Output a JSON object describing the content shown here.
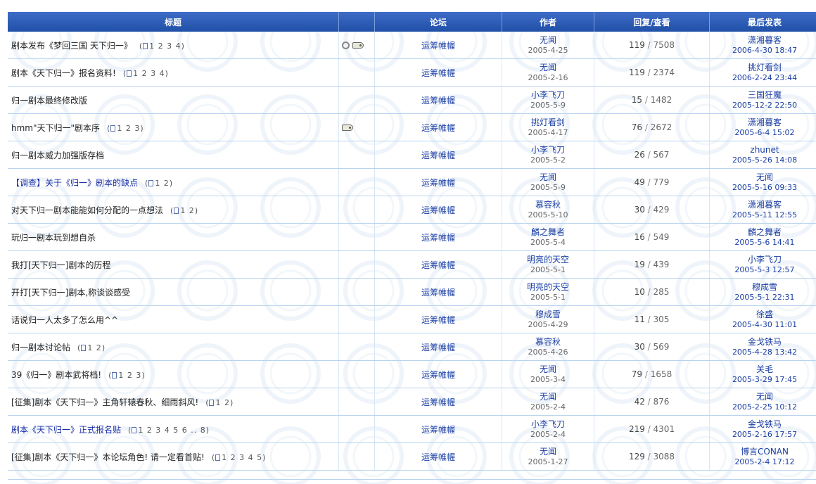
{
  "header": {
    "title": "标题",
    "forum": "论坛",
    "author": "作者",
    "reply_view": "回复/查看",
    "last_post": "最后发表"
  },
  "rows": [
    {
      "title": "剧本发布《梦回三国 天下归一》",
      "bold": false,
      "pages": "1 2 3 4",
      "attachment": true,
      "tagicon": true,
      "forum": "运筹帷幄",
      "author": "无闻",
      "date": "2005-4-25",
      "replies": "119",
      "views": "7508",
      "last_user": "潇湘暮客",
      "last_time": "2006-4-30 18:47"
    },
    {
      "title": "剧本《天下归一》报名资料!",
      "bold": false,
      "pages": "1 2 3 4",
      "attachment": false,
      "tagicon": false,
      "forum": "运筹帷幄",
      "author": "无闻",
      "date": "2005-2-16",
      "replies": "119",
      "views": "2374",
      "last_user": "挑灯看剑",
      "last_time": "2006-2-24 23:44"
    },
    {
      "title": "归一剧本最终修改版",
      "bold": false,
      "pages": "",
      "attachment": false,
      "tagicon": false,
      "forum": "运筹帷幄",
      "author": "小李飞刀",
      "date": "2005-5-9",
      "replies": "15",
      "views": "1482",
      "last_user": "三国狂魔",
      "last_time": "2005-12-2 22:50"
    },
    {
      "title": "hmm\"天下归一\"剧本序",
      "bold": false,
      "pages": "1 2 3",
      "attachment": false,
      "tagicon": true,
      "forum": "运筹帷幄",
      "author": "挑灯看剑",
      "date": "2005-4-17",
      "replies": "76",
      "views": "2672",
      "last_user": "潇湘暮客",
      "last_time": "2005-6-4 15:02"
    },
    {
      "title": "归一剧本威力加强版存档",
      "bold": false,
      "pages": "",
      "attachment": false,
      "tagicon": false,
      "forum": "运筹帷幄",
      "author": "小李飞刀",
      "date": "2005-5-2",
      "replies": "26",
      "views": "567",
      "last_user": "zhunet",
      "last_time": "2005-5-26 14:08"
    },
    {
      "title": "【调查】关于《归一》剧本的缺点",
      "bold": true,
      "pages": "1 2",
      "attachment": false,
      "tagicon": false,
      "forum": "运筹帷幄",
      "author": "无闻",
      "date": "2005-5-9",
      "replies": "49",
      "views": "779",
      "last_user": "无闻",
      "last_time": "2005-5-16 09:33"
    },
    {
      "title": "对天下归一剧本能能如何分配的一点想法",
      "bold": false,
      "pages": "1 2",
      "attachment": false,
      "tagicon": false,
      "forum": "运筹帷幄",
      "author": "慕容秋",
      "date": "2005-5-10",
      "replies": "30",
      "views": "429",
      "last_user": "潇湘暮客",
      "last_time": "2005-5-11 12:55"
    },
    {
      "title": "玩归一剧本玩到想自杀",
      "bold": false,
      "pages": "",
      "attachment": false,
      "tagicon": false,
      "forum": "运筹帷幄",
      "author": "麟之舞者",
      "date": "2005-5-4",
      "replies": "16",
      "views": "549",
      "last_user": "麟之舞者",
      "last_time": "2005-5-6 14:41"
    },
    {
      "title": "我打[天下归一]剧本的历程",
      "bold": false,
      "pages": "",
      "attachment": false,
      "tagicon": false,
      "forum": "运筹帷幄",
      "author": "明亮的天空",
      "date": "2005-5-1",
      "replies": "19",
      "views": "439",
      "last_user": "小李飞刀",
      "last_time": "2005-5-3 12:57"
    },
    {
      "title": "开打[天下归一]剧本,称谈谈感受",
      "bold": false,
      "pages": "",
      "attachment": false,
      "tagicon": false,
      "forum": "运筹帷幄",
      "author": "明亮的天空",
      "date": "2005-5-1",
      "replies": "10",
      "views": "285",
      "last_user": "穆成雪",
      "last_time": "2005-5-1 22:31"
    },
    {
      "title": "话说归一人太多了怎么用^^",
      "bold": false,
      "pages": "",
      "attachment": false,
      "tagicon": false,
      "forum": "运筹帷幄",
      "author": "穆成雪",
      "date": "2005-4-29",
      "replies": "11",
      "views": "305",
      "last_user": "徐盛",
      "last_time": "2005-4-30 11:01"
    },
    {
      "title": "归一剧本讨论帖",
      "bold": false,
      "pages": "1 2",
      "attachment": false,
      "tagicon": false,
      "forum": "运筹帷幄",
      "author": "慕容秋",
      "date": "2005-4-26",
      "replies": "30",
      "views": "569",
      "last_user": "金戈铁马",
      "last_time": "2005-4-28 13:42"
    },
    {
      "title": "39《归一》剧本武将档!",
      "bold": false,
      "pages": "1 2 3",
      "attachment": false,
      "tagicon": false,
      "forum": "运筹帷幄",
      "author": "无闻",
      "date": "2005-3-4",
      "replies": "79",
      "views": "1658",
      "last_user": "关毛",
      "last_time": "2005-3-29 17:45"
    },
    {
      "title": "[征集]剧本《天下归一》主角轩辕春秋、细雨斜风!",
      "bold": false,
      "pages": "1 2",
      "attachment": false,
      "tagicon": false,
      "forum": "运筹帷幄",
      "author": "无闻",
      "date": "2005-2-4",
      "replies": "42",
      "views": "876",
      "last_user": "无闻",
      "last_time": "2005-2-25 10:12"
    },
    {
      "title": "剧本《天下归一》正式报名贴",
      "bold": true,
      "pages": "1 2 3 4 5 6 .. 8",
      "attachment": false,
      "tagicon": false,
      "forum": "运筹帷幄",
      "author": "小李飞刀",
      "date": "2005-2-4",
      "replies": "219",
      "views": "4301",
      "last_user": "金戈铁马",
      "last_time": "2005-2-16 17:57"
    },
    {
      "title": "[征集]剧本《天下归一》本论坛角色! 请一定看首贴!",
      "bold": false,
      "pages": "1 2 3 4 5",
      "attachment": false,
      "tagicon": false,
      "forum": "运筹帷幄",
      "author": "无闻",
      "date": "2005-1-27",
      "replies": "129",
      "views": "3088",
      "last_user": "博言CONAN",
      "last_time": "2005-2-4 17:12"
    }
  ]
}
